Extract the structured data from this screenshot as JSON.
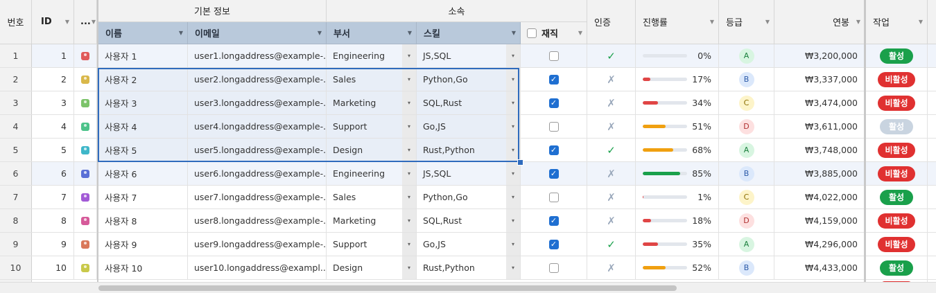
{
  "header": {
    "rownum": "번호",
    "id": "ID",
    "more": "...",
    "group_basic": "기본 정보",
    "group_affil": "소속",
    "name": "이름",
    "email": "이메일",
    "dept": "부서",
    "skill": "스킬",
    "employed": "재직",
    "auth": "인증",
    "progress": "진행률",
    "grade": "등급",
    "salary": "연봉",
    "action": "작업"
  },
  "colors": {
    "accent": "#1f6fd1",
    "active": "#1aa04b",
    "inactive": "#e03131",
    "disabled": "#c9d4e0",
    "check_ok": "#1aa04b",
    "check_no": "#9aa8bb"
  },
  "rows": [
    {
      "n": "1",
      "id": "1",
      "avatar": "#e05a5a",
      "name": "사용자 1",
      "email": "user1.longaddress@example-...",
      "dept": "Engineering",
      "skill": "JS,SQL",
      "employed": false,
      "auth": "✓",
      "progress": 0,
      "progress_text": "0%",
      "grade": "A",
      "salary": "₩3,200,000",
      "status": "활성"
    },
    {
      "n": "2",
      "id": "2",
      "avatar": "#d9b84a",
      "name": "사용자 2",
      "email": "user2.longaddress@example-...",
      "dept": "Sales",
      "skill": "Python,Go",
      "employed": true,
      "auth": "✗",
      "progress": 17,
      "progress_text": "17%",
      "grade": "B",
      "salary": "₩3,337,000",
      "status": "비활성"
    },
    {
      "n": "3",
      "id": "3",
      "avatar": "#7cc36a",
      "name": "사용자 3",
      "email": "user3.longaddress@example-...",
      "dept": "Marketing",
      "skill": "SQL,Rust",
      "employed": true,
      "auth": "✗",
      "progress": 34,
      "progress_text": "34%",
      "grade": "C",
      "salary": "₩3,474,000",
      "status": "비활성"
    },
    {
      "n": "4",
      "id": "4",
      "avatar": "#4cc38a",
      "name": "사용자 4",
      "email": "user4.longaddress@example-...",
      "dept": "Support",
      "skill": "Go,JS",
      "employed": false,
      "auth": "✗",
      "progress": 51,
      "progress_text": "51%",
      "grade": "D",
      "salary": "₩3,611,000",
      "status": "활성"
    },
    {
      "n": "5",
      "id": "5",
      "avatar": "#3fb7c9",
      "name": "사용자 5",
      "email": "user5.longaddress@example-...",
      "dept": "Design",
      "skill": "Rust,Python",
      "employed": true,
      "auth": "✓",
      "progress": 68,
      "progress_text": "68%",
      "grade": "A",
      "salary": "₩3,748,000",
      "status": "비활성"
    },
    {
      "n": "6",
      "id": "6",
      "avatar": "#5a6fd6",
      "name": "사용자 6",
      "email": "user6.longaddress@example-...",
      "dept": "Engineering",
      "skill": "JS,SQL",
      "employed": true,
      "auth": "✗",
      "progress": 85,
      "progress_text": "85%",
      "grade": "B",
      "salary": "₩3,885,000",
      "status": "비활성"
    },
    {
      "n": "7",
      "id": "7",
      "avatar": "#a25ad6",
      "name": "사용자 7",
      "email": "user7.longaddress@example-...",
      "dept": "Sales",
      "skill": "Python,Go",
      "employed": false,
      "auth": "✗",
      "progress": 1,
      "progress_text": "1%",
      "grade": "C",
      "salary": "₩4,022,000",
      "status": "활성"
    },
    {
      "n": "8",
      "id": "8",
      "avatar": "#d65a9a",
      "name": "사용자 8",
      "email": "user8.longaddress@example-...",
      "dept": "Marketing",
      "skill": "SQL,Rust",
      "employed": true,
      "auth": "✗",
      "progress": 18,
      "progress_text": "18%",
      "grade": "D",
      "salary": "₩4,159,000",
      "status": "비활성"
    },
    {
      "n": "9",
      "id": "9",
      "avatar": "#d9785a",
      "name": "사용자 9",
      "email": "user9.longaddress@example-...",
      "dept": "Support",
      "skill": "Go,JS",
      "employed": true,
      "auth": "✓",
      "progress": 35,
      "progress_text": "35%",
      "grade": "A",
      "salary": "₩4,296,000",
      "status": "비활성"
    },
    {
      "n": "10",
      "id": "10",
      "avatar": "#c9c94a",
      "name": "사용자 10",
      "email": "user10.longaddress@exampl...",
      "dept": "Design",
      "skill": "Rust,Python",
      "employed": false,
      "auth": "✗",
      "progress": 52,
      "progress_text": "52%",
      "grade": "B",
      "salary": "₩4,433,000",
      "status": "활성"
    }
  ]
}
